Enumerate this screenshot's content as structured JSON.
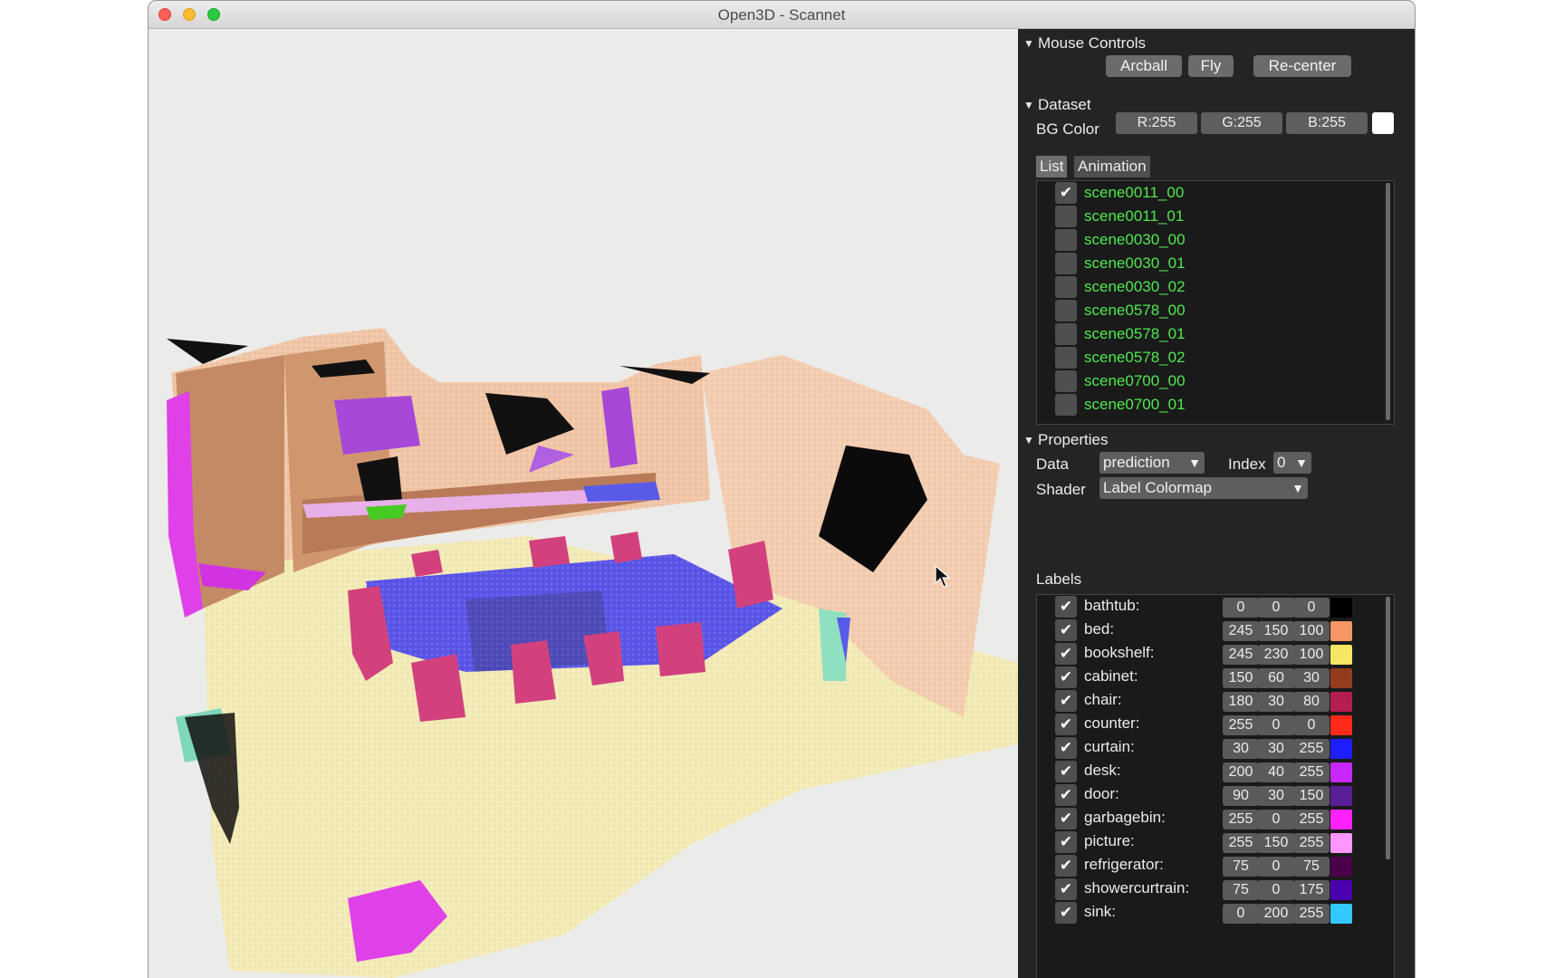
{
  "window": {
    "title": "Open3D - Scannet"
  },
  "mouse_controls": {
    "header": "Mouse Controls",
    "buttons": [
      "Arcball",
      "Fly",
      "Re-center"
    ]
  },
  "dataset": {
    "header": "Dataset",
    "bg_color_label": "BG Color",
    "r": "R:255",
    "g": "G:255",
    "b": "B:255",
    "swatch_color": "#ffffff",
    "tabs": [
      "List",
      "Animation"
    ],
    "scenes": [
      {
        "name": "scene0011_00",
        "checked": true
      },
      {
        "name": "scene0011_01",
        "checked": false
      },
      {
        "name": "scene0030_00",
        "checked": false
      },
      {
        "name": "scene0030_01",
        "checked": false
      },
      {
        "name": "scene0030_02",
        "checked": false
      },
      {
        "name": "scene0578_00",
        "checked": false
      },
      {
        "name": "scene0578_01",
        "checked": false
      },
      {
        "name": "scene0578_02",
        "checked": false
      },
      {
        "name": "scene0700_00",
        "checked": false
      },
      {
        "name": "scene0700_01",
        "checked": false
      }
    ]
  },
  "properties": {
    "header": "Properties",
    "data_label": "Data",
    "data_value": "prediction",
    "index_label": "Index",
    "index_value": "0",
    "shader_label": "Shader",
    "shader_value": "Label Colormap"
  },
  "labels": {
    "header": "Labels",
    "items": [
      {
        "name": "bathtub:",
        "r": "0",
        "g": "0",
        "b": "0",
        "color": "#000000"
      },
      {
        "name": "bed:",
        "r": "245",
        "g": "150",
        "b": "100",
        "color": "#f59664"
      },
      {
        "name": "bookshelf:",
        "r": "245",
        "g": "230",
        "b": "100",
        "color": "#f5e664"
      },
      {
        "name": "cabinet:",
        "r": "150",
        "g": "60",
        "b": "30",
        "color": "#963c1e"
      },
      {
        "name": "chair:",
        "r": "180",
        "g": "30",
        "b": "80",
        "color": "#b41e50"
      },
      {
        "name": "counter:",
        "r": "255",
        "g": "0",
        "b": "0",
        "color": "#ff2a1a"
      },
      {
        "name": "curtain:",
        "r": "30",
        "g": "30",
        "b": "255",
        "color": "#1e1eff"
      },
      {
        "name": "desk:",
        "r": "200",
        "g": "40",
        "b": "255",
        "color": "#c828ff"
      },
      {
        "name": "door:",
        "r": "90",
        "g": "30",
        "b": "150",
        "color": "#5a1e96"
      },
      {
        "name": "garbagebin:",
        "r": "255",
        "g": "0",
        "b": "255",
        "color": "#ff22ff"
      },
      {
        "name": "picture:",
        "r": "255",
        "g": "150",
        "b": "255",
        "color": "#ff96ff"
      },
      {
        "name": "refrigerator:",
        "r": "75",
        "g": "0",
        "b": "75",
        "color": "#4b004b"
      },
      {
        "name": "showercurtrain:",
        "r": "75",
        "g": "0",
        "b": "175",
        "color": "#4b00af"
      },
      {
        "name": "sink:",
        "r": "0",
        "g": "200",
        "b": "255",
        "color": "#33c8ff"
      }
    ]
  }
}
